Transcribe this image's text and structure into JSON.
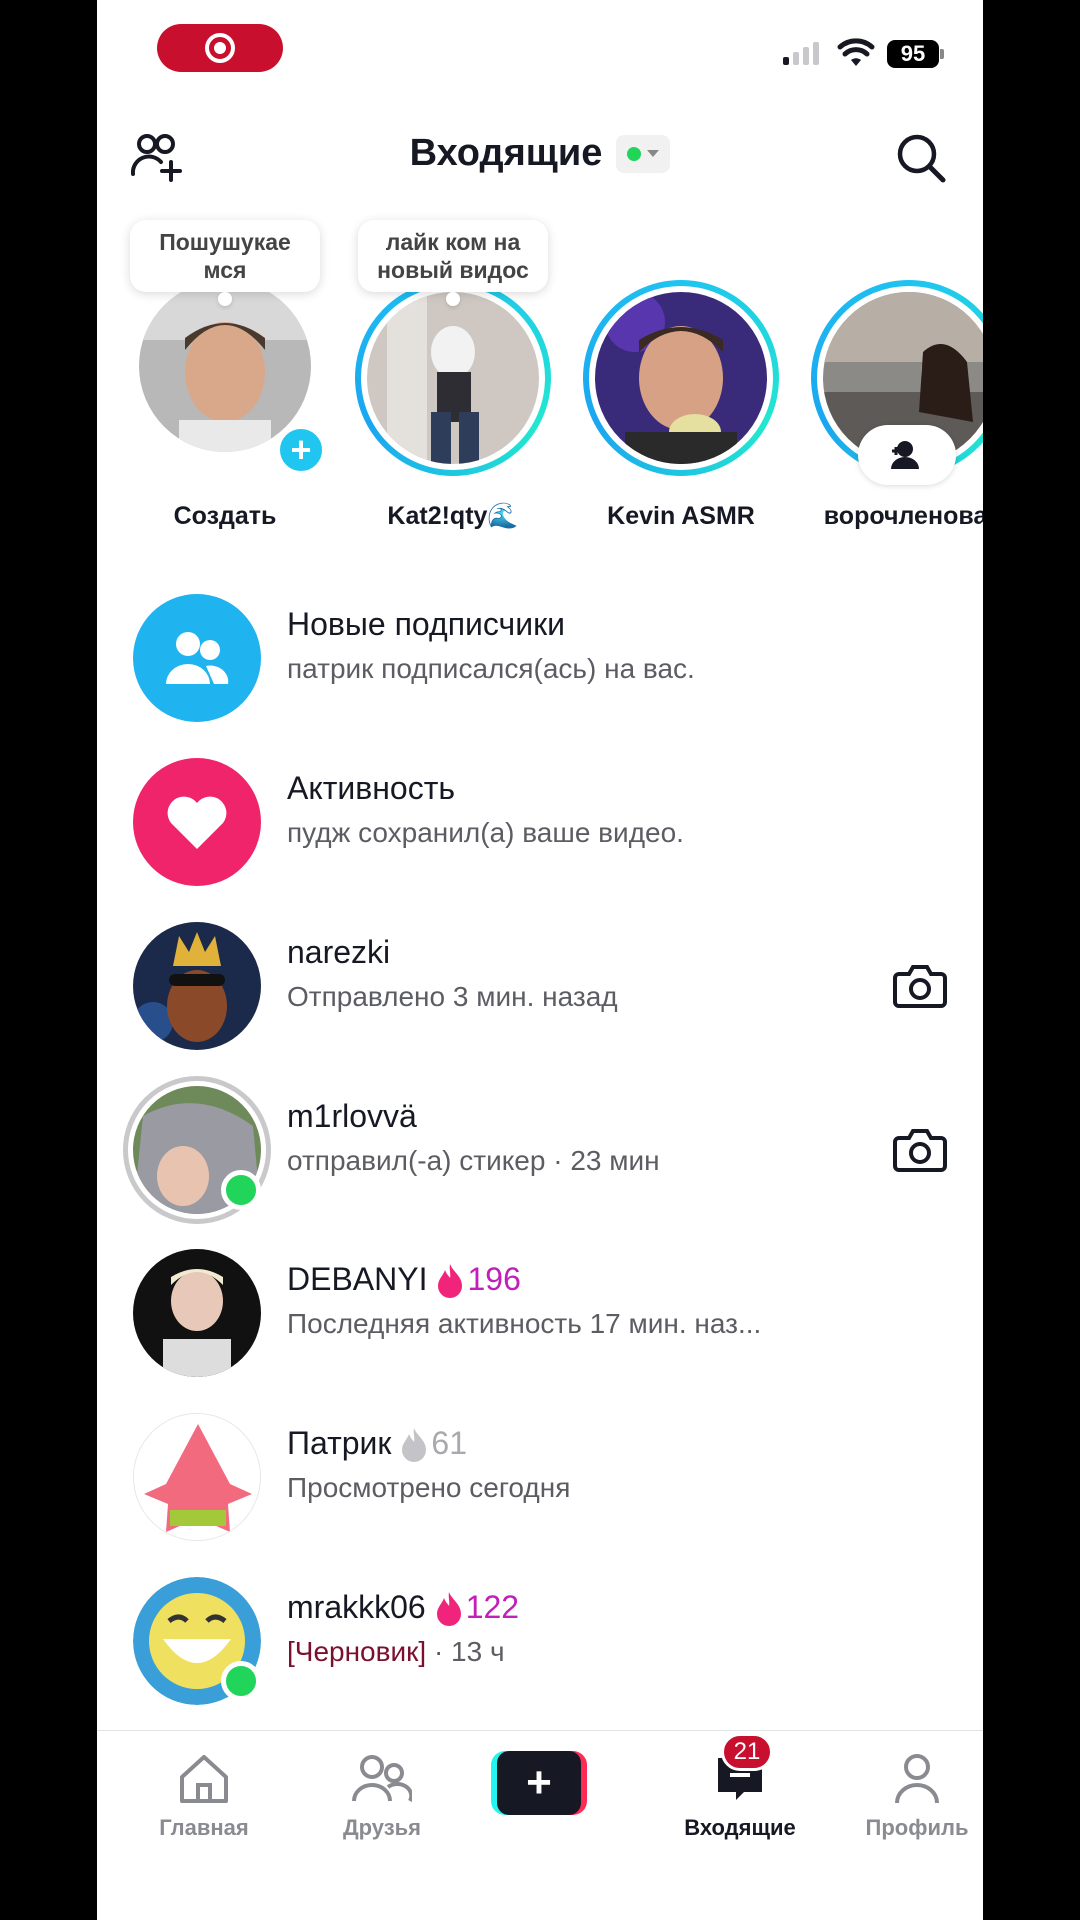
{
  "status_bar": {
    "battery": "95"
  },
  "header": {
    "title": "Входящие"
  },
  "stories": [
    {
      "name": "Создать",
      "note": "Пошушукае мся"
    },
    {
      "name": "Kat2!qty🌊",
      "note": "лайк ком на новый видос"
    },
    {
      "name": "Kevin ASMR"
    },
    {
      "name": "ворочленова."
    }
  ],
  "system_rows": [
    {
      "title": "Новые подписчики",
      "subtitle": "патрик подписался(ась) на вас.",
      "icon": "followers-icon",
      "color": "#1fb3f0"
    },
    {
      "title": "Активность",
      "subtitle": "пудж сохранил(а) ваше видео.",
      "icon": "heart-icon",
      "color": "#f0246a"
    }
  ],
  "chats": [
    {
      "name": "narezki",
      "subtitle": "Отправлено 3 мин. назад"
    },
    {
      "name": "m1rlovvä",
      "subtitle": "отправил(-а) стикер · 23 мин"
    },
    {
      "name": "DEBANYI",
      "streak": "196",
      "subtitle": "Последняя активность 17 мин. наз..."
    },
    {
      "name": "Патрик",
      "streak": "61",
      "subtitle": "Просмотрено сегодня"
    },
    {
      "name": "mrakkk06",
      "streak": "122",
      "draft": "[Черновик]",
      "subtitle": " · 13 ч"
    }
  ],
  "tabbar": {
    "home": "Главная",
    "friends": "Друзья",
    "inbox": "Входящие",
    "profile": "Профиль",
    "inbox_badge": "21"
  },
  "colors": {
    "accent": "#fe2c55",
    "cyan": "#25f4ee",
    "streak_active": "#c21fb8",
    "streak_inactive": "#a8a8ad",
    "online": "#20d55a"
  }
}
